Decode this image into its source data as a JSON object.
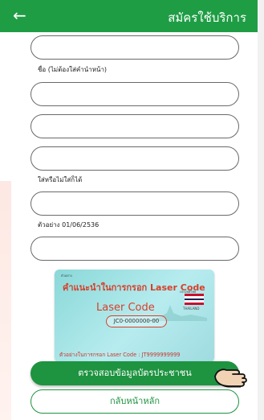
{
  "header": {
    "back_icon": "arrow-left-icon",
    "title": "สมัครใช้บริการ",
    "color": "#1f9d45"
  },
  "form": {
    "name_hint": "ชื่อ (ไม่ต้องใส่คำนำหน้า)",
    "optional_hint": "ใส่หรือไม่ใส่ก็ได้",
    "date_hint": "ตัวอย่าง 01/06/2536"
  },
  "card": {
    "small_text": "ตัวอย่าง",
    "title": "คำแนะนำในการกรอก Laser Code",
    "flag_label": "ประเทศไทย",
    "flag_country": "THAILAND",
    "laser_label": "Laser Code",
    "laser_value": "JC0-0000000-00",
    "example": "ตัวอย่างในการกรอก Laser Code : JT9999999999"
  },
  "buttons": {
    "verify": "ตรวจสอบข้อมูลบัตรประชาชน",
    "home": "กลับหน้าหลัก"
  },
  "colors": {
    "accent": "#1e9340",
    "highlight": "#d6402b"
  }
}
